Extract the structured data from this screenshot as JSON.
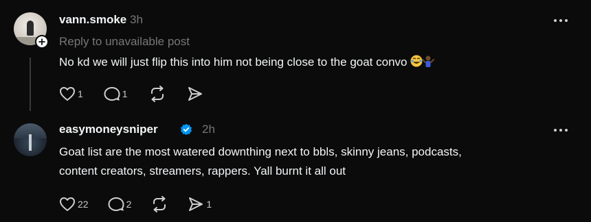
{
  "posts": [
    {
      "username": "vann.smoke",
      "time": "3h",
      "reply_context": "Reply to unavailable post",
      "text": "No kd we will just flip this into him not being close to the goat convo",
      "emoji": "crying-laughing-shrug-emoji",
      "verified": false,
      "likes": "1",
      "comments": "1",
      "reposts": "",
      "shares": ""
    },
    {
      "username": "easymoneysniper",
      "time": "2h",
      "lines": [
        "Goat list are the most watered downthing next to bbls, skinny jeans, podcasts,",
        "content creators, streamers, rappers. Yall burnt it all out"
      ],
      "verified": true,
      "likes": "22",
      "comments": "2",
      "reposts": "",
      "shares": "1"
    }
  ],
  "icons": {
    "like": "heart-icon",
    "comment": "comment-bubble-icon",
    "repost": "repost-icon",
    "share": "send-icon",
    "more": "more-options-icon",
    "follow": "plus-icon",
    "verified": "verified-badge-icon"
  },
  "colors": {
    "background": "#0b0b0b",
    "text": "#f3f5f7",
    "muted": "#777777",
    "verified": "#0095f6"
  }
}
